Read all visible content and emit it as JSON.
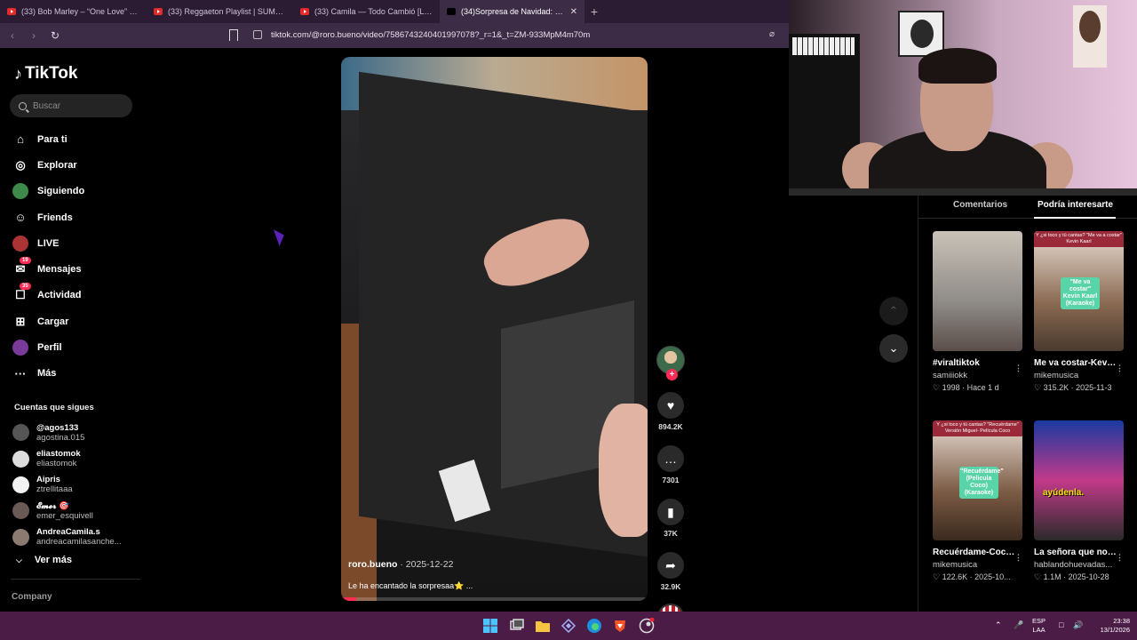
{
  "browser": {
    "tabs": [
      {
        "title": "(33) Bob Marley – “One Love” and “R",
        "active": false
      },
      {
        "title": "(33) Reggaeton Playlist | SUMMER",
        "active": false
      },
      {
        "title": "(33) Camila — Todo Cambió [Letra] -",
        "active": false
      },
      {
        "title": "(34)Sorpresa de Navidad: Car",
        "active": true
      }
    ],
    "new_tab": "+",
    "url": "tiktok.com/@roro.bueno/video/7586743240401997078?_r=1&_t=ZM-933MpM4m70m"
  },
  "tiktok": {
    "brand": "TikTok",
    "search_placeholder": "Buscar",
    "nav": [
      {
        "label": "Para ti",
        "icon": "home-icon"
      },
      {
        "label": "Explorar",
        "icon": "compass-icon"
      },
      {
        "label": "Siguiendo",
        "icon": "following-avatar-icon"
      },
      {
        "label": "Friends",
        "icon": "friends-icon"
      },
      {
        "label": "LIVE",
        "icon": "live-avatar-icon"
      },
      {
        "label": "Mensajes",
        "icon": "messages-icon",
        "badge": "19"
      },
      {
        "label": "Actividad",
        "icon": "activity-icon",
        "badge": "35"
      },
      {
        "label": "Cargar",
        "icon": "upload-icon"
      },
      {
        "label": "Perfil",
        "icon": "profile-avatar-icon"
      },
      {
        "label": "Más",
        "icon": "more-icon"
      }
    ],
    "following_title": "Cuentas que sigues",
    "following": [
      {
        "username": "@agos133",
        "name": "agostina.015",
        "color": "#555555"
      },
      {
        "username": "eliastomok",
        "name": "eliastomok",
        "color": "#dddddd"
      },
      {
        "username": "Aipris",
        "name": "ztrellitaaa",
        "color": "#f2f2f2"
      },
      {
        "username": "𝓔𝓶𝓮𝓻 🎯",
        "name": "emer_esquivell",
        "color": "#6a5a55"
      },
      {
        "username": "AndreaCamila.s",
        "name": "andreacamilasanche...",
        "color": "#8a7a70"
      }
    ],
    "see_more": "Ver más",
    "company": "Company"
  },
  "video": {
    "author": "roro.bueno",
    "date": "2025-12-22",
    "caption": "Le ha encantado la sorpresaa⭐ ...",
    "progress": 0.05
  },
  "actions": {
    "likes": "894.2K",
    "comments": "7301",
    "saves": "37K",
    "shares": "32.9K"
  },
  "right_panel": {
    "tabs": [
      "Comentarios",
      "Podría interesarte"
    ],
    "cards": [
      {
        "title": "#viraltiktok",
        "author": "samiiiokk",
        "likes": "1998",
        "time": "Hace 1 d",
        "thumb": "girl"
      },
      {
        "title": "Me va costar-Kevin Kaarl...",
        "author": "mikemusica",
        "likes": "315.2K",
        "time": "2025-11-3",
        "thumb": "guitar",
        "top": "Y ¿si toco y tú cantas? \"Me va a costar\" Kevin Kaarl",
        "label": "\"Me va costar\" Kevin Kaarl (Karaoke)"
      },
      {
        "title": "Recuérdame-Coco #karaoke #coco...",
        "author": "mikemusica",
        "likes": "122.6K",
        "time": "2025-10...",
        "thumb": "guitar2",
        "top": "Y ¿si toco y tú cantas? \"Recuérdame\" Versión Miguel- Película Coco",
        "label": "\"Recuérdame\" (Película Coco) (Karaoke)"
      },
      {
        "title": "La señora que no escucha bien...",
        "author": "hablandohuevadas...",
        "likes": "1.1M",
        "time": "2025-10-28",
        "thumb": "man",
        "yellow": "ayúdenla."
      }
    ]
  },
  "taskbar": {
    "lang1": "ESP",
    "lang2": "LAA",
    "time": "23:38",
    "date": "13/1/2026"
  },
  "colors": {
    "accent": "#fe2c55",
    "tabbar": "#2b1c33",
    "taskbar": "#4b1d46"
  }
}
